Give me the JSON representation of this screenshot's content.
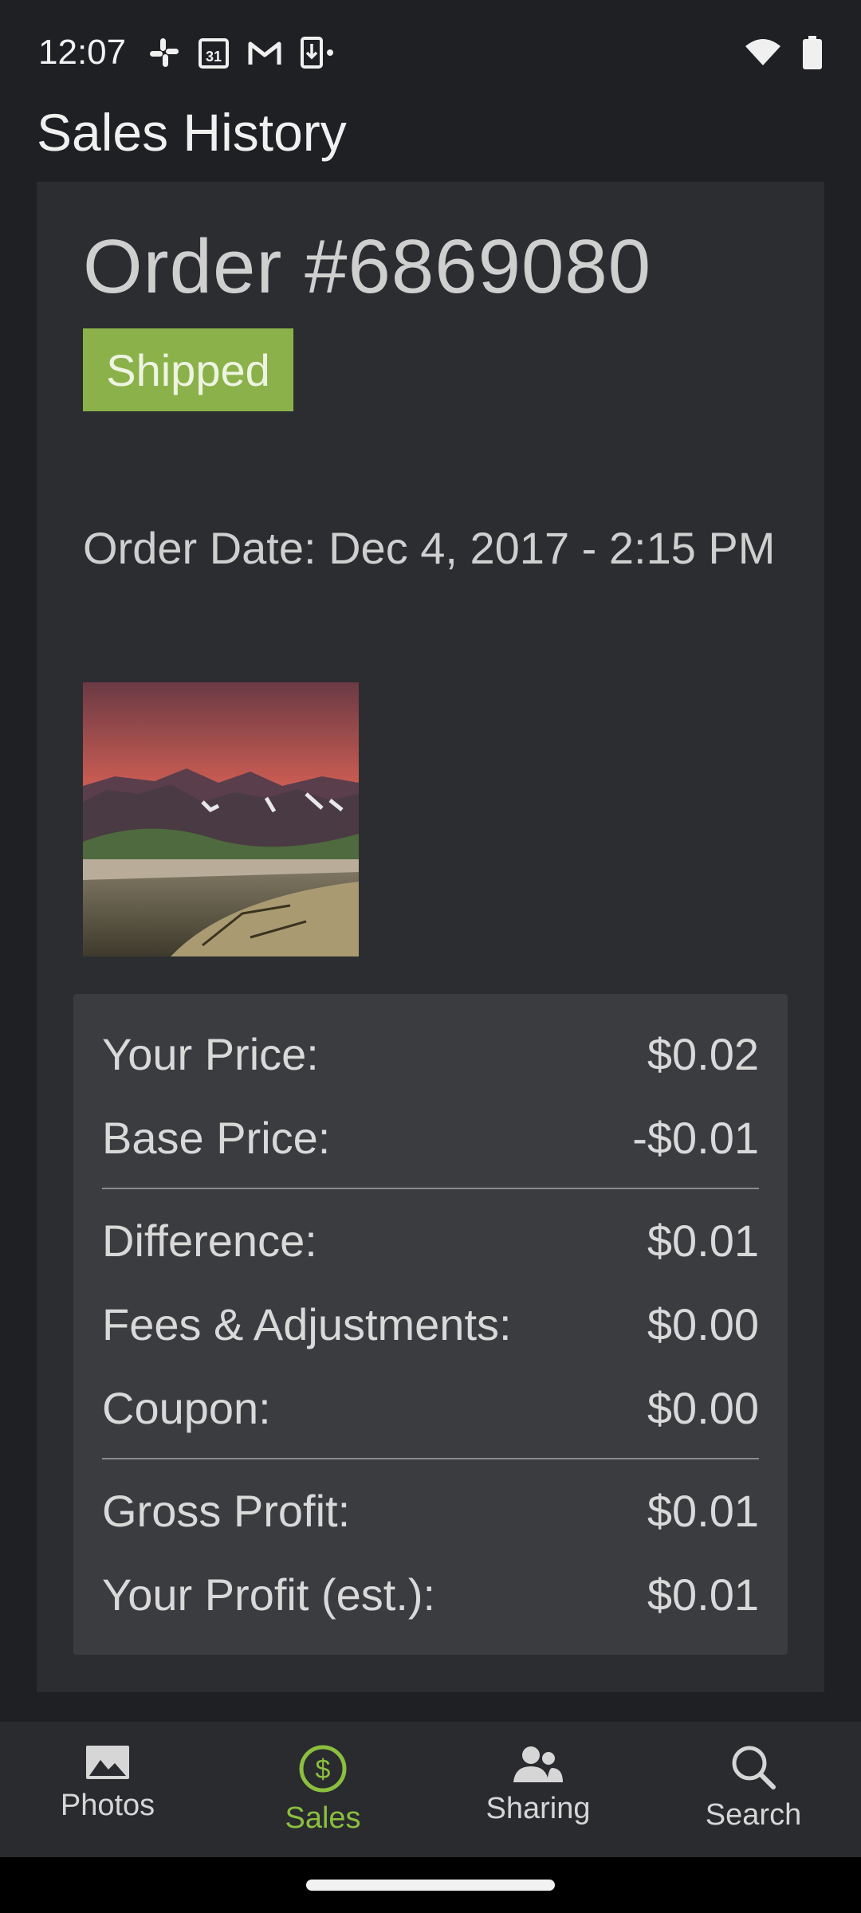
{
  "status_bar": {
    "time": "12:07",
    "icons_left": [
      "slack-icon",
      "calendar-icon",
      "gmail-icon",
      "download-icon"
    ],
    "calendar_day": "31",
    "icons_right": [
      "wifi-icon",
      "battery-icon"
    ]
  },
  "header": {
    "title": "Sales History"
  },
  "order": {
    "title": "Order #6869080",
    "status": "Shipped",
    "status_color": "#8bb24a",
    "date": "Order Date: Dec 4, 2017 - 2:15 PM"
  },
  "pricing": {
    "rows": [
      {
        "label": "Your Price:",
        "value": "$0.02"
      },
      {
        "label": "Base Price:",
        "value": "-$0.01"
      },
      {
        "label": "Difference:",
        "value": "$0.01"
      },
      {
        "label": "Fees & Adjustments:",
        "value": "$0.00"
      },
      {
        "label": "Coupon:",
        "value": "$0.00"
      },
      {
        "label": "Gross Profit:",
        "value": "$0.01"
      },
      {
        "label": "Your Profit (est.):",
        "value": "$0.01"
      }
    ]
  },
  "nav": {
    "accent_color": "#8bbf3e",
    "items": [
      {
        "label": "Photos",
        "icon": "photo-icon",
        "active": false
      },
      {
        "label": "Sales",
        "icon": "dollar-circle-icon",
        "active": true
      },
      {
        "label": "Sharing",
        "icon": "people-icon",
        "active": false
      },
      {
        "label": "Search",
        "icon": "search-icon",
        "active": false
      }
    ]
  }
}
